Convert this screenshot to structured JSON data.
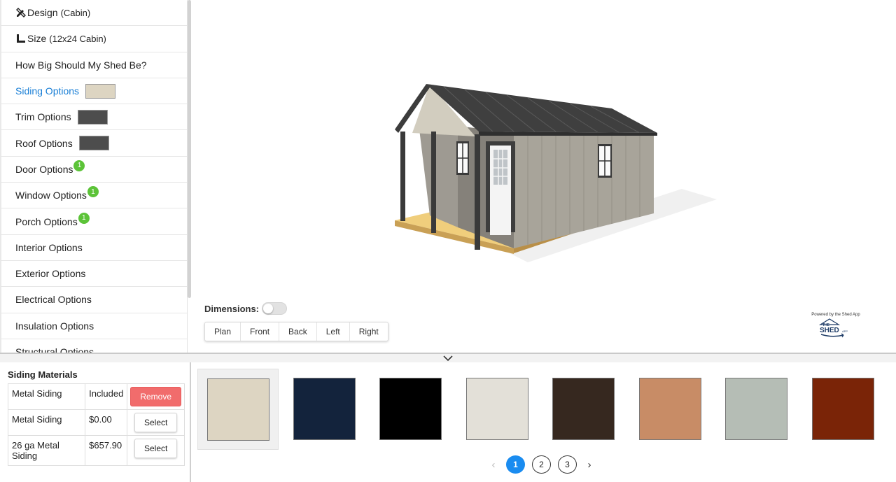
{
  "sidebar": {
    "items": [
      {
        "label": "Design",
        "sub": "(Cabin)",
        "icon": "pencil-ruler-icon"
      },
      {
        "label": "Size",
        "sub": "(12x24 Cabin)",
        "icon": "ruler-corner-icon"
      },
      {
        "label": "How Big Should My Shed Be?"
      },
      {
        "label": "Siding Options",
        "swatch": "#ddd5c2",
        "active": true
      },
      {
        "label": "Trim Options",
        "swatch": "#4d4d4d"
      },
      {
        "label": "Roof Options",
        "swatch": "#4d4d4d"
      },
      {
        "label": "Door Options",
        "badge": "1"
      },
      {
        "label": "Window Options",
        "badge": "1"
      },
      {
        "label": "Porch Options",
        "badge": "1"
      },
      {
        "label": "Interior Options"
      },
      {
        "label": "Exterior Options"
      },
      {
        "label": "Electrical Options"
      },
      {
        "label": "Insulation Options"
      },
      {
        "label": "Structural Options"
      }
    ]
  },
  "viewer": {
    "dimensions_label": "Dimensions:",
    "views": [
      "Plan",
      "Front",
      "Back",
      "Left",
      "Right"
    ],
    "powered_by": "Powered by the Shed App",
    "logo_text": "SHED",
    "logo_top": "THE",
    "logo_suffix": "APP"
  },
  "materials": {
    "title": "Siding Materials",
    "rows": [
      {
        "name": "Metal Siding",
        "price": "Included",
        "action": "Remove"
      },
      {
        "name": "Metal Siding",
        "price": "$0.00",
        "action": "Select"
      },
      {
        "name": "26 ga Metal Siding",
        "price": "$657.90",
        "action": "Select"
      }
    ]
  },
  "swatches": [
    "#ddd5c2",
    "#13233c",
    "#000000",
    "#e3e0d8",
    "#36281f",
    "#c88c66",
    "#b5bdb5",
    "#7a2407"
  ],
  "pagination": {
    "pages": [
      "1",
      "2",
      "3"
    ],
    "current": "1",
    "prev": "‹",
    "next": "›"
  }
}
